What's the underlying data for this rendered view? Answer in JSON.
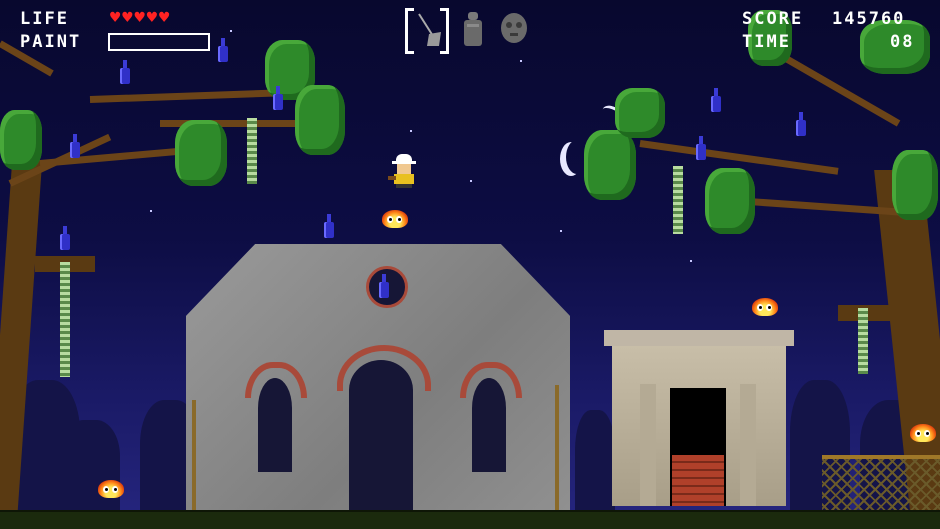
{
  "hud": {
    "life_label": "LIFE",
    "paint_label": "PAINT",
    "score_label": "SCORE",
    "score_value": "145760",
    "time_label": "TIME",
    "time_value": "08",
    "life_hearts": 5,
    "paint_fill": 0
  },
  "inventory": {
    "items": [
      "broom-icon",
      "paint-can-icon",
      "ghost-face-icon"
    ],
    "selected": "broom-icon"
  },
  "colors": {
    "sky": "#0d0d44",
    "heart": "#ff2222",
    "bottle": "#3030c8",
    "foliage": "#2e8a2a",
    "stone": "#8e8e8e",
    "brick": "#a84a3a"
  }
}
